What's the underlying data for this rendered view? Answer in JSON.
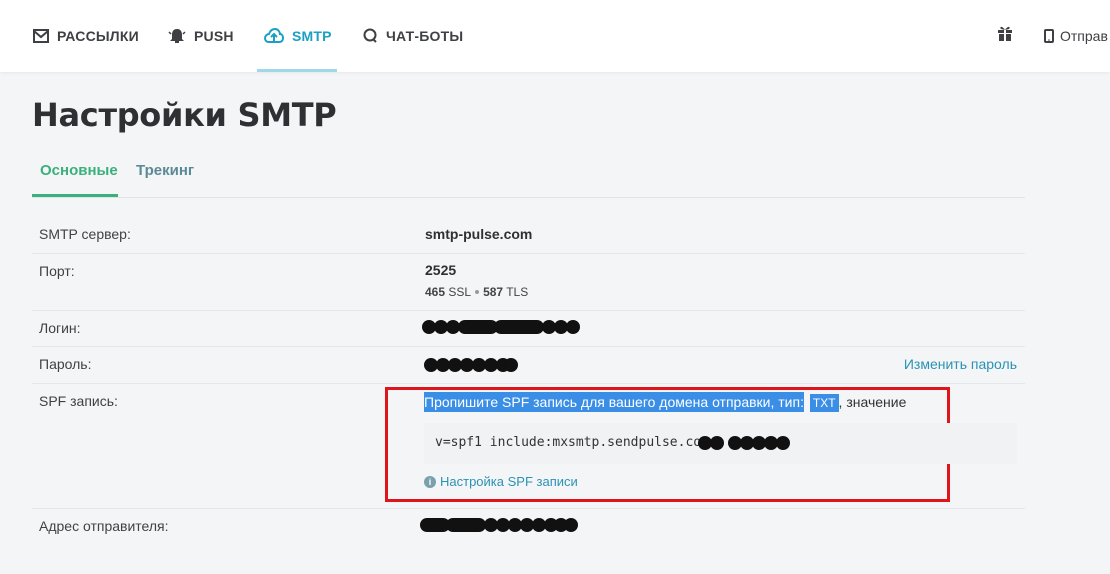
{
  "nav": {
    "items": [
      {
        "label": "РАССЫЛКИ",
        "icon": "envelope-icon"
      },
      {
        "label": "PUSH",
        "icon": "bell-icon"
      },
      {
        "label": "SMTP",
        "icon": "cloud-upload-icon"
      },
      {
        "label": "ЧАТ-БОТЫ",
        "icon": "chat-icon"
      }
    ],
    "active": "SMTP",
    "gift_icon": "gift-icon",
    "send_label": "Отправ",
    "send_icon": "mobile-phone-icon"
  },
  "page": {
    "title": "Настройки SMTP"
  },
  "tabs": {
    "main": "Основные",
    "tracking": "Трекинг"
  },
  "settings": {
    "server_label": "SMTP сервер:",
    "server_value": "smtp-pulse.com",
    "port_label": "Порт:",
    "port_value": "2525",
    "ssl_port": "465",
    "ssl_label": "SSL",
    "tls_port": "587",
    "tls_label": "TLS",
    "login_label": "Логин:",
    "password_label": "Пароль:",
    "change_password": "Изменить пароль",
    "spf_label": "SPF запись:",
    "spf_instruction": "Пропишите SPF запись для вашего домена отправки, тип:",
    "spf_type": "TXT",
    "spf_value_word": ", значение",
    "spf_code": "v=spf1 include:mxsmtp.sendpulse.com",
    "spf_help_link": "Настройка SPF записи",
    "sender_label": "Адрес отправителя:"
  },
  "colors": {
    "accent_blue": "#1aa0c4",
    "accent_green": "#3ab17d",
    "highlight": "#e0141b"
  }
}
